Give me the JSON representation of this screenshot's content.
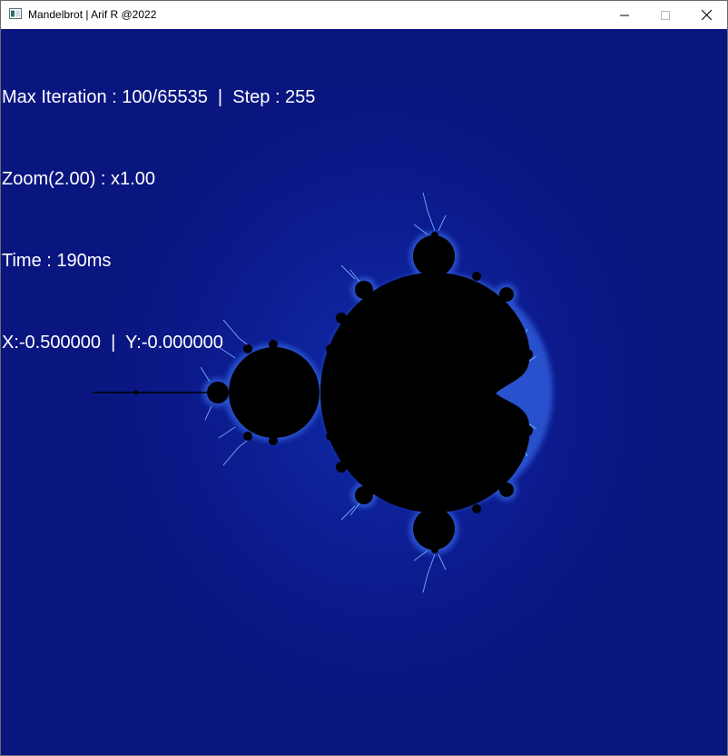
{
  "window": {
    "title": "Mandelbrot | Arif R @2022",
    "icon": "app-window-icon",
    "controls": {
      "minimize_icon": "minimize-icon",
      "maximize_icon": "maximize-icon",
      "close_icon": "close-icon"
    }
  },
  "overlay": {
    "max_iteration": "Max Iteration : 100/65535  |  Step : 255",
    "zoom": "Zoom(2.00) : x1.00",
    "time": "Time : 190ms",
    "coordinates": "X:-0.500000  |  Y:-0.000000"
  },
  "colors": {
    "background": "#0b1888",
    "set_fill": "#000000",
    "edge_glow": "#4a8fff",
    "text": "#ffffff"
  }
}
